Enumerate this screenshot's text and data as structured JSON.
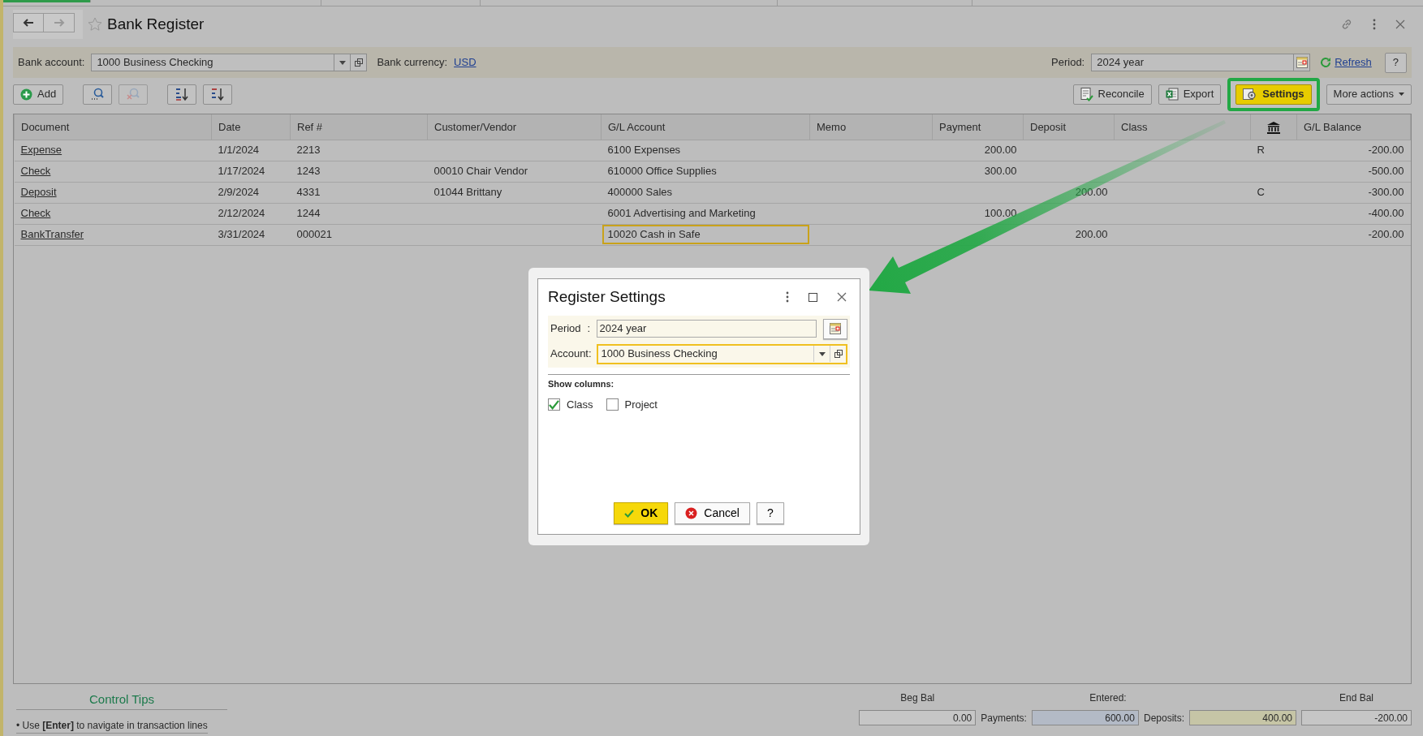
{
  "window": {
    "title": "Bank Register"
  },
  "filter": {
    "bank_account": {
      "label": "Bank account:",
      "value": "1000 Business Checking"
    },
    "currency": {
      "label": "Bank currency:",
      "value": "USD"
    },
    "period": {
      "label": "Period:",
      "value": "2024 year"
    },
    "refresh": "Refresh",
    "help": "?"
  },
  "toolbar": {
    "add": "Add",
    "right_buttons": [
      {
        "label": "Reconcile",
        "kind": "reconcile",
        "highlighted": false
      },
      {
        "label": "Export",
        "kind": "export",
        "highlighted": false
      },
      {
        "label": "Settings",
        "kind": "settings",
        "highlighted": true
      },
      {
        "label": "More actions",
        "kind": "menu",
        "highlighted": false
      }
    ]
  },
  "table": {
    "columns": [
      {
        "label": "Document",
        "kind": "link"
      },
      {
        "label": "Date",
        "kind": "text"
      },
      {
        "label": "Ref #",
        "kind": "text"
      },
      {
        "label": "Customer/Vendor",
        "kind": "text"
      },
      {
        "label": "G/L Account",
        "kind": "text"
      },
      {
        "label": "Memo",
        "kind": "text"
      },
      {
        "label": "Payment",
        "kind": "amount"
      },
      {
        "label": "Deposit",
        "kind": "amount"
      },
      {
        "label": "Class",
        "kind": "text"
      },
      {
        "kind": "icon"
      },
      {
        "label": "G/L Balance",
        "kind": "amount"
      }
    ],
    "rows": [
      {
        "cells": [
          "Expense",
          "1/1/2024",
          "2213",
          "",
          "6100 Expenses",
          "",
          "200.00",
          "",
          "",
          "R",
          "-200.00"
        ],
        "focused": false
      },
      {
        "cells": [
          "Check",
          "1/17/2024",
          "1243",
          "00010 Chair Vendor",
          "610000 Office Supplies",
          "",
          "300.00",
          "",
          "",
          "",
          "-500.00"
        ],
        "focused": false
      },
      {
        "cells": [
          "Deposit",
          "2/9/2024",
          "4331",
          "01044 Brittany",
          "400000 Sales",
          "",
          "",
          "200.00",
          "",
          "C",
          "-300.00"
        ],
        "focused": false
      },
      {
        "cells": [
          "Check",
          "2/12/2024",
          "1244",
          "",
          "6001 Advertising and Marketing",
          "",
          "100.00",
          "",
          "",
          "",
          "-400.00"
        ],
        "focused": false
      },
      {
        "cells": [
          "BankTransfer",
          "3/31/2024",
          "000021",
          "",
          "10020 Cash in Safe",
          "",
          "",
          "200.00",
          "",
          "",
          "-200.00"
        ],
        "focused": true
      }
    ]
  },
  "footer": {
    "tips_title": "Control Tips",
    "tip": "• Use **[Enter]** to navigate in transaction lines",
    "beg_bal": {
      "label": "Beg Bal",
      "value": "0.00"
    },
    "entered": "Entered:",
    "payments": {
      "label": "Payments:",
      "value": "600.00"
    },
    "deposits": {
      "label": "Deposits:",
      "value": "400.00"
    },
    "end_bal": {
      "label": "End Bal",
      "value": "-200.00"
    }
  },
  "dialog": {
    "title": "Register Settings",
    "period": {
      "label": "Period",
      "separator": ":",
      "value": "2024 year"
    },
    "account": {
      "label": "Account:",
      "value": "1000 Business Checking"
    },
    "show_columns": "Show columns:",
    "checkboxes": [
      {
        "label": "Class",
        "checked": true
      },
      {
        "label": "Project",
        "checked": false
      }
    ],
    "buttons": [
      {
        "label": "OK",
        "kind": "ok"
      },
      {
        "label": "Cancel",
        "kind": "cancel"
      },
      {
        "label": "?",
        "kind": "help"
      }
    ]
  }
}
